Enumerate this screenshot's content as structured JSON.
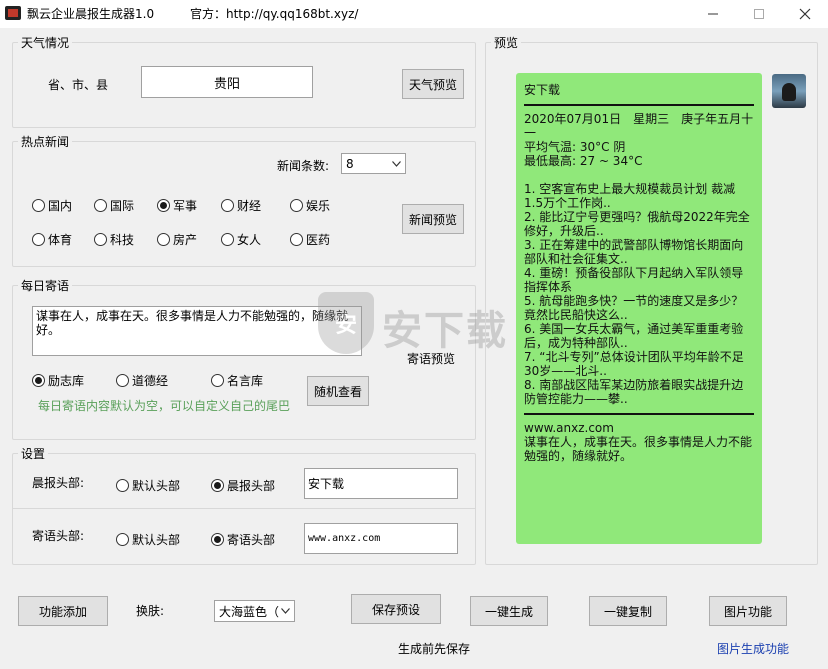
{
  "window": {
    "title": "飘云企业晨报生成器1.0",
    "official": "官方：http://qy.qq168bt.xyz/"
  },
  "weather": {
    "group_label": "天气情况",
    "region_label": "省、市、县",
    "city_value": "贵阳",
    "preview_button": "天气预览"
  },
  "news": {
    "group_label": "热点新闻",
    "count_label": "新闻条数:",
    "count_value": "8",
    "categories": [
      {
        "label": "国内",
        "checked": false
      },
      {
        "label": "国际",
        "checked": false
      },
      {
        "label": "军事",
        "checked": true
      },
      {
        "label": "财经",
        "checked": false
      },
      {
        "label": "娱乐",
        "checked": false
      },
      {
        "label": "体育",
        "checked": false
      },
      {
        "label": "科技",
        "checked": false
      },
      {
        "label": "房产",
        "checked": false
      },
      {
        "label": "女人",
        "checked": false
      },
      {
        "label": "医药",
        "checked": false
      }
    ],
    "preview_button": "新闻预览"
  },
  "quote": {
    "group_label": "每日寄语",
    "text": "谋事在人，成事在天。很多事情是人力不能勉强的，随缘就好。",
    "preview_button": "寄语预览",
    "sources": [
      {
        "label": "励志库",
        "checked": true
      },
      {
        "label": "道德经",
        "checked": false
      },
      {
        "label": "名言库",
        "checked": false
      }
    ],
    "random_button": "随机查看",
    "hint": "每日寄语内容默认为空，可以自定义自己的尾巴"
  },
  "settings": {
    "group_label": "设置",
    "morning_header_label": "晨报头部:",
    "morning_options": [
      {
        "label": "默认头部",
        "checked": false
      },
      {
        "label": "晨报头部",
        "checked": true
      }
    ],
    "morning_header_value": "安下载",
    "quote_header_label": "寄语头部:",
    "quote_options": [
      {
        "label": "默认头部",
        "checked": false
      },
      {
        "label": "寄语头部",
        "checked": true
      }
    ],
    "quote_header_value": "www.anxz.com"
  },
  "preview": {
    "group_label": "预览",
    "header": "安下载",
    "date_line": "2020年07月01日　星期三　庚子年五月十一",
    "temp_avg": "平均气温: 30°C 阴",
    "temp_range": "最低最高: 27 ~ 34°C",
    "news_items": [
      "1. 空客宣布史上最大规模裁员计划 裁减1.5万个工作岗..",
      "2. 能比辽宁号更强吗？俄航母2022年完全修好，升级后..",
      "3. 正在筹建中的武警部队博物馆长期面向部队和社会征集文..",
      "4. 重磅！预备役部队下月起纳入军队领导指挥体系",
      "5. 航母能跑多快？一节的速度又是多少？竟然比民船快这么..",
      "6. 美国一女兵太霸气，通过美军重重考验后，成为特种部队..",
      "7. “北斗专列”总体设计团队平均年龄不足30岁——北斗..",
      "8. 南部战区陆军某边防旅着眼实战提升边防管控能力——攀.."
    ],
    "footer_site": "www.anxz.com",
    "footer_quote": "谋事在人，成事在天。很多事情是人力不能勉强的，随缘就好。"
  },
  "toolbar": {
    "add_feature": "功能添加",
    "skin_label": "换肤:",
    "skin_value": "大海蓝色（",
    "save_preset": "保存预设",
    "generate": "一键生成",
    "copy": "一键复制",
    "image_feature": "图片功能"
  },
  "status": {
    "save_hint": "生成前先保存",
    "image_link": "图片生成功能"
  },
  "watermark": {
    "shield_char": "安",
    "text": "安下载"
  },
  "colors": {
    "bubble": "#90e87a",
    "hint": "#5aa05a",
    "link": "#1a3fb0"
  }
}
